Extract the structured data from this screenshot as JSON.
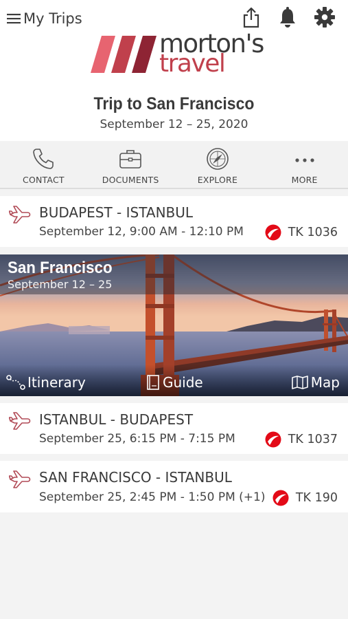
{
  "header": {
    "back_label": "My Trips",
    "icons": {
      "share": "share-icon",
      "notifications": "bell-icon",
      "settings": "gear-icon",
      "menu": "hamburger-icon"
    }
  },
  "logo": {
    "name": "morton's",
    "sub": "travel",
    "colors": [
      "#e76470",
      "#c0404c",
      "#8e2434"
    ]
  },
  "trip": {
    "title": "Trip to San Francisco",
    "dates": "September 12 – 25, 2020"
  },
  "actions": [
    {
      "label": "CONTACT",
      "icon": "phone-icon"
    },
    {
      "label": "DOCUMENTS",
      "icon": "briefcase-icon"
    },
    {
      "label": "EXPLORE",
      "icon": "compass-icon"
    },
    {
      "label": "MORE",
      "icon": "more-icon"
    }
  ],
  "flights": [
    {
      "route": "BUDAPEST - ISTANBUL",
      "time": "September 12, 9:00 AM - 12:10 PM",
      "flight_no": "TK 1036"
    },
    {
      "route": "ISTANBUL - BUDAPEST",
      "time": "September 25, 6:15 PM - 7:15 PM",
      "flight_no": "TK 1037"
    },
    {
      "route": "SAN FRANCISCO - ISTANBUL",
      "time": "September 25, 2:45 PM - 1:50 PM (+1)",
      "flight_no": "TK 190"
    }
  ],
  "destination": {
    "city": "San Francisco",
    "dates": "September 12 – 25",
    "links": {
      "itinerary": "Itinerary",
      "guide": "Guide",
      "map": "Map"
    }
  },
  "colors": {
    "accent": "#c0404c",
    "airline_red": "#e30a17",
    "plane_icon": "#b14a56"
  }
}
